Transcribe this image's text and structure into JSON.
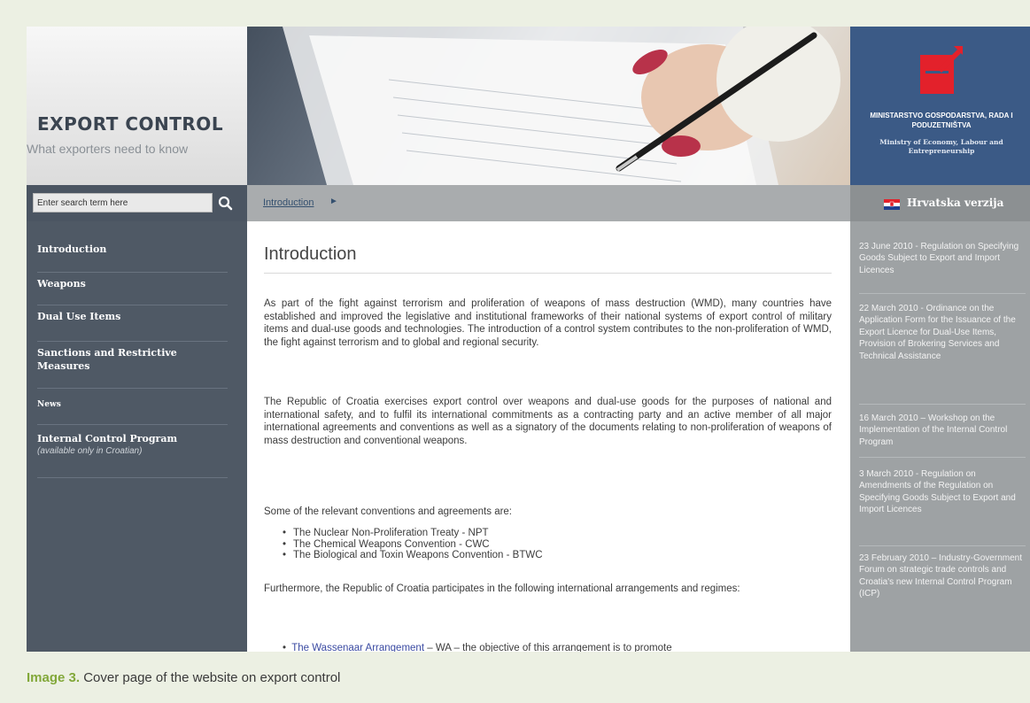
{
  "brand": {
    "title": "EXPORT CONTROL",
    "subtitle": "What exporters need to know"
  },
  "ministry": {
    "name_hr": "MINISTARSTVO GOSPODARSTVA, RADA I PODUZETNIŠTVA",
    "name_en": "Ministry of Economy, Labour and Entrepreneurship"
  },
  "search": {
    "value": "Enter search term here"
  },
  "breadcrumb": {
    "current": "Introduction"
  },
  "language": {
    "label": "Hrvatska verzija"
  },
  "nav": {
    "items": [
      {
        "label": "Introduction",
        "note": ""
      },
      {
        "label": "Weapons",
        "note": ""
      },
      {
        "label": "Dual Use Items",
        "note": ""
      },
      {
        "label": "Sanctions and Restrictive Measures",
        "note": ""
      },
      {
        "label": "News",
        "note": ""
      },
      {
        "label": "Internal Control Program",
        "note": "(available only in Croatian)"
      }
    ]
  },
  "content": {
    "title": "Introduction",
    "p1": "As part of the fight against terrorism and proliferation of weapons of mass destruction (WMD), many countries have established and improved the legislative and institutional frameworks of their national systems of export control of military items and dual-use goods and technologies. The introduction of a control system contributes to the non-proliferation of WMD, the fight against terrorism and to global and regional security.",
    "p2": "The Republic of Croatia exercises export control over weapons and dual-use goods for the purposes of national and international safety, and to fulfil its international commitments as a contracting party and an active member of all major international agreements and conventions as well as a signatory of the documents relating to non-proliferation of weapons of mass destruction and conventional weapons.",
    "p3": "Some of the relevant conventions and agreements are:",
    "conventions": [
      "The Nuclear Non-Proliferation Treaty - NPT",
      "The Chemical Weapons Convention - CWC",
      "The Biological and Toxin Weapons Convention - BTWC"
    ],
    "p4": "Furthermore, the Republic of Croatia participates in the following international arrangements and regimes:",
    "wa_link": "The Wassenaar Arrangement",
    "wa_text": " – WA – the objective of this arrangement is to promote"
  },
  "news": [
    "23 June 2010 - Regulation on Specifying Goods Subject to Export and Import Licences",
    "22 March 2010 - Ordinance on the Application Form for the Issuance of the Export Licence for Dual-Use Items, Provision of Brokering Services and Technical Assistance",
    "16 March 2010 – Workshop on the Implementation of the Internal Control Program",
    "3 March 2010 - Regulation on Amendments of the Regulation on Specifying Goods Subject to Export and Import Licences",
    "23 February 2010 – Industry-Government Forum on strategic trade controls and Croatia's new Internal Control Program (ICP)"
  ],
  "caption": {
    "label": "Image 3.",
    "text": " Cover page of the website on export control"
  },
  "colors": {
    "sidebar": "#4f5965",
    "ministry": "#3b5a86",
    "news": "#9ea2a4",
    "caption_accent": "#82a83a",
    "page_bg": "#ecf0e3"
  }
}
